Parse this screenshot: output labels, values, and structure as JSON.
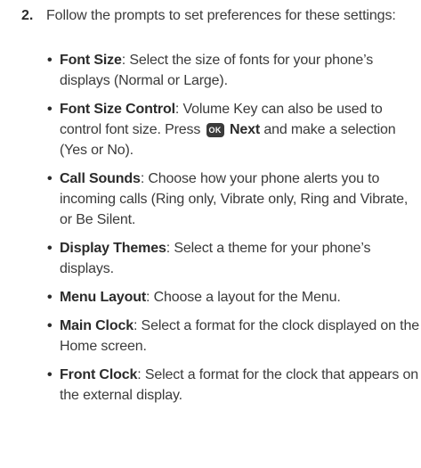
{
  "step": {
    "number": "2.",
    "intro": "Follow the prompts to set preferences for these settings:"
  },
  "items": [
    {
      "term": "Font Size",
      "text": ": Select the size of fonts for your phone’s displays (Normal or Large)."
    },
    {
      "term": "Font Size Control",
      "text_before": ": Volume Key can also be used to control font size. Press ",
      "key_label": "OK",
      "next_label": "Next",
      "text_after": " and make a selection (Yes or No)."
    },
    {
      "term": "Call Sounds",
      "text": ": Choose how your phone alerts you to incoming calls (Ring only, Vibrate only, Ring and Vibrate, or Be Silent."
    },
    {
      "term": "Display Themes",
      "text": ": Select a theme for your phone’s displays."
    },
    {
      "term": "Menu Layout",
      "text": ": Choose a layout for the Menu."
    },
    {
      "term": "Main Clock",
      "text": ": Select a format for the clock displayed on the Home screen."
    },
    {
      "term": "Front Clock",
      "text": ": Select a format for the clock that appears on the external display."
    }
  ],
  "bullet_char": "•",
  "icons": {
    "ok_key": "ok-key-icon"
  },
  "colors": {
    "text": "#3a3a3a",
    "bold_text": "#2b2b2b",
    "key_background": "#3b3b3b",
    "key_text": "#ffffff"
  }
}
